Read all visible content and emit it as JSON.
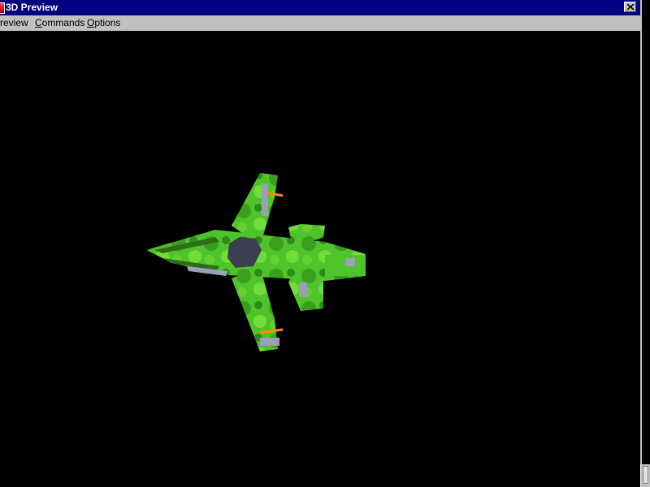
{
  "window": {
    "title": "3D Preview",
    "close_symbol": "x"
  },
  "menu": {
    "items": [
      {
        "label": "Preview",
        "visible_text": "review"
      },
      {
        "label": "Commands",
        "accel": "C",
        "rest": "ommands"
      },
      {
        "label": "Options",
        "accel": "O",
        "rest": "ptions"
      }
    ]
  },
  "viewport": {
    "background": "#000000",
    "model_name": "green-jet-fighter",
    "model_colors": {
      "primary": "#4fc42a",
      "secondary": "#2e8c1a",
      "metal": "#9aa0b8",
      "cockpit": "#3c3f52",
      "accent": "#ff8c00"
    }
  },
  "colors": {
    "titlebar": "#000080",
    "menubar": "#c0c0c0"
  }
}
